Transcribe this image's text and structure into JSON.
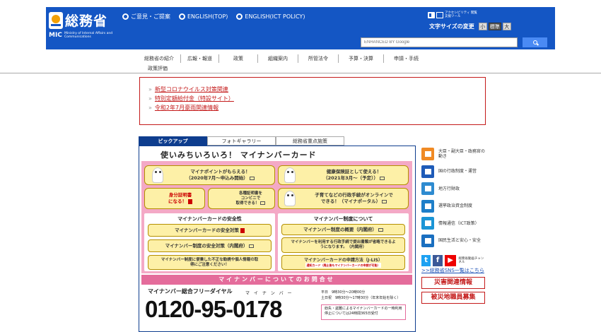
{
  "header": {
    "logo_text": "総務省",
    "logo_mic": "MIC",
    "logo_sub": "Ministry of Internal Affairs and Communications",
    "links": [
      {
        "label": "ご意見・ご提案"
      },
      {
        "label": "ENGLISH(TOP)"
      },
      {
        "label": "ENGLISH(ICT POLICY)"
      }
    ],
    "accessibility_text": "アクセシビリティ 閲覧支援ツール",
    "font_size_label": "文字サイズの変更",
    "font_sizes": [
      "小",
      "標準",
      "大"
    ],
    "search_placeholder": "ENHANCED BY Google"
  },
  "nav": {
    "row1": [
      "総務省の紹介",
      "広報・報道",
      "政策",
      "組織案内",
      "所管法令",
      "予算・決算",
      "申請・手続"
    ],
    "row2": [
      "政策評価"
    ]
  },
  "notice": {
    "links": [
      "新型コロナウイルス対策関連",
      "特別定額給付金（特設サイト）",
      "令和2年7月豪雨関連情報"
    ]
  },
  "tabs": [
    "ピックアップ",
    "フォトギャラリー",
    "総務省重点施策"
  ],
  "banner": {
    "title": "使いみちいろいろ！ マイナンバーカード",
    "card1_line1": "マイナポイントがもらえる！",
    "card1_line2": "（2020年7月〜申込み開始）",
    "card2_line1": "健康保険証として使える！",
    "card2_line2": "（2021年3月〜（予定））",
    "card3_line1": "身分証明書",
    "card3_line2": "になる！",
    "card4_line1": "各種証明書を",
    "card4_line2": "コンビニで",
    "card4_line3": "取得できる！",
    "card5_line1": "子育てなどの行政手続がオンラインで",
    "card5_line2": "できる！（マイナポータル）",
    "safety_title": "マイナンバーカードの安全性",
    "safety_links": [
      "マイナンバーカードの安全対策",
      "マイナンバー制度の安全対策（内閣府）",
      "マイナンバー制度に便乗した不正な勧誘や個人情報の取得にご注意ください！"
    ],
    "about_title": "マイナンバー制度について",
    "about_links": [
      "マイナンバー制度の概要（内閣府）",
      "マイナンバーを利用する行政手続で提出書類が省略できるようになります。（内閣府）",
      "マイナンバーカードの申請方法（J-LIS）"
    ],
    "about_note": "通知カード（廃止後もマイナンバーカードの申請が可能）",
    "contact_head": "マイナンバーについてのお問合せ",
    "dial_label": "マイナンバー総合フリーダイヤル",
    "dial_ruby": "マ イ ナ ン バ ー",
    "phone": "0120-95-0178",
    "hours_line1": "平日　9時30分〜20時00分",
    "hours_line2": "土日祝　9時30分〜17時30分（年末年始を除く）",
    "note_text": "紛失・盗難によるマイナンバーカードの一時利用停止については24時間365日受付"
  },
  "sidebar": {
    "items": [
      {
        "label": "大臣・副大臣・政務官の動き",
        "color": "#f08a24"
      },
      {
        "label": "国の行政制度・運営",
        "color": "#1e5bb8"
      },
      {
        "label": "地方行財政",
        "color": "#2e8bd0"
      },
      {
        "label": "選挙政治資金制度",
        "color": "#1e7fc9"
      },
      {
        "label": "情報通信（ICT政策）",
        "color": "#1b95d6"
      },
      {
        "label": "国民生活と安心・安全",
        "color": "#1a6fc0"
      }
    ],
    "yt_label": "総務省動画チャンネル",
    "sns_link": ">>総務省SNS一覧はこちら",
    "red_buttons": [
      "災害関連情報",
      "被災地職員募集"
    ]
  }
}
